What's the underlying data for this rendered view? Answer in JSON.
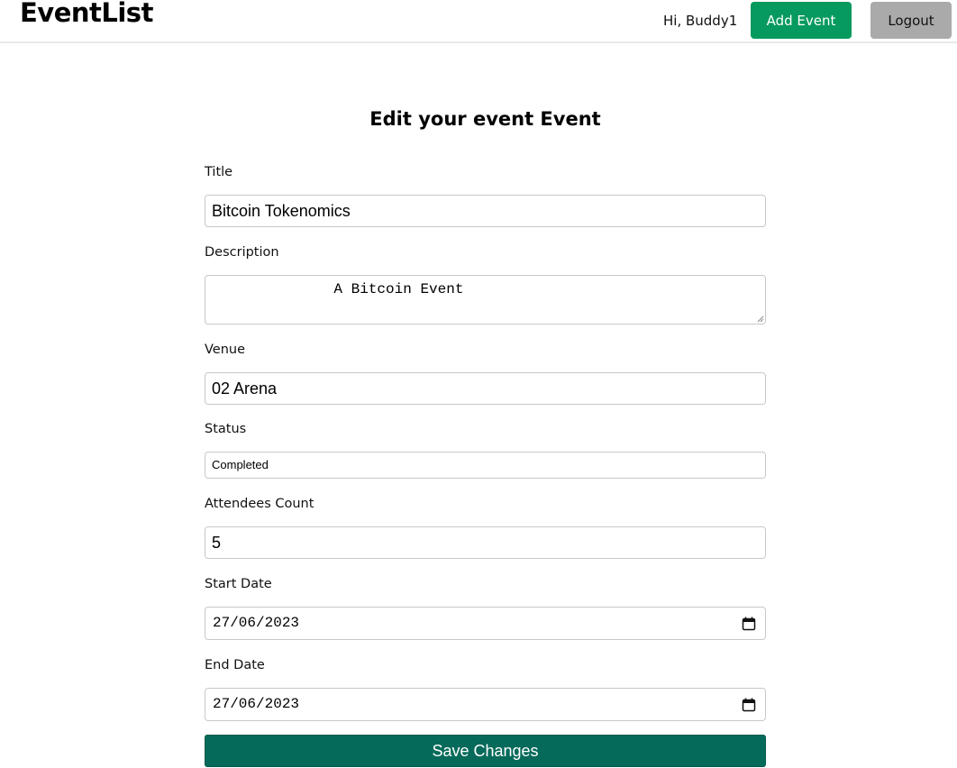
{
  "navbar": {
    "brand": "EventList",
    "greeting": "Hi, Buddy1",
    "add_event_label": "Add Event",
    "logout_label": "Logout"
  },
  "form": {
    "heading": "Edit your event Event",
    "title": {
      "label": "Title",
      "value": "Bitcoin Tokenomics"
    },
    "description": {
      "label": "Description",
      "value": "              A Bitcoin Event"
    },
    "venue": {
      "label": "Venue",
      "value": "02 Arena"
    },
    "status": {
      "label": "Status",
      "value": "Completed"
    },
    "attendees": {
      "label": "Attendees Count",
      "value": "5"
    },
    "start_date": {
      "label": "Start Date",
      "value": "27/06/2023"
    },
    "end_date": {
      "label": "End Date",
      "value": "27/06/2023"
    },
    "submit_label": "Save Changes"
  },
  "icons": {
    "calendar": "calendar-icon",
    "resize_grip": "resize-grip-icon"
  },
  "colors": {
    "add_event_bg": "#079a5e",
    "logout_bg": "#aaaaaa",
    "save_bg": "#066a5a",
    "field_border": "#c8c8c8"
  }
}
